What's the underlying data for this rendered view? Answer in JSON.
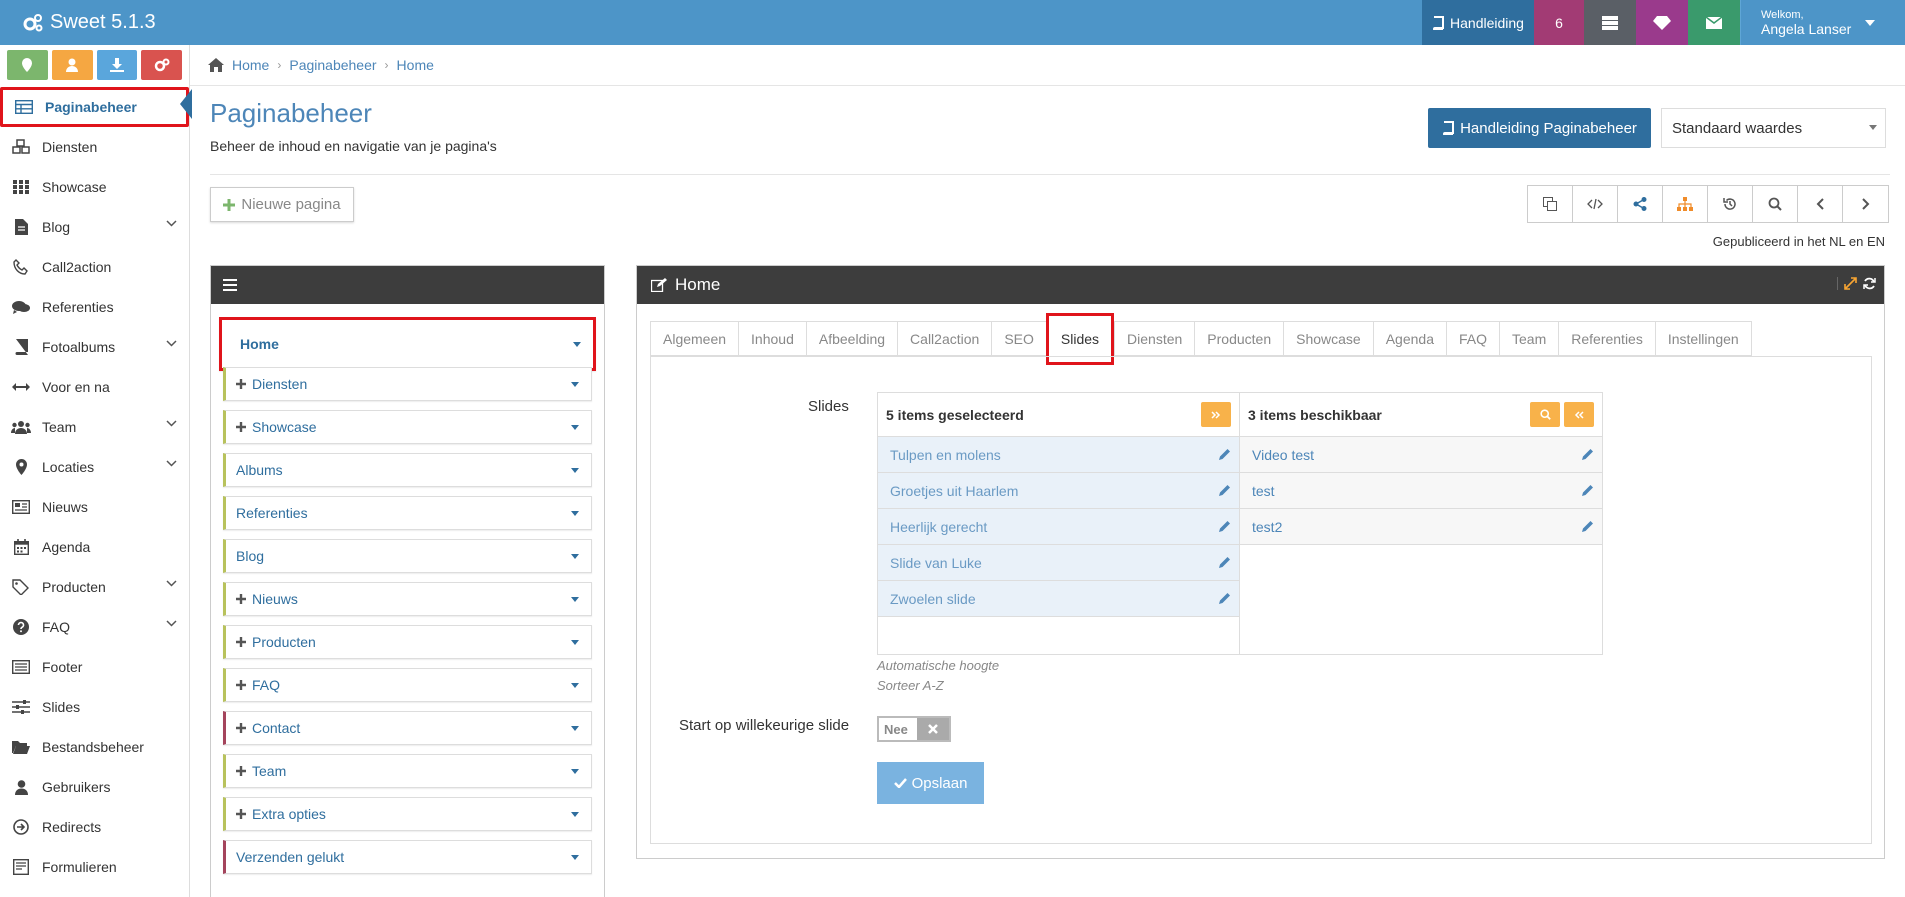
{
  "app": {
    "title": "Sweet 5.1.3"
  },
  "topbar": {
    "manual_label": "Handleiding",
    "notifications": "6",
    "welcome": "Welkom,",
    "user_name": "Angela Lanser"
  },
  "sidebar": {
    "items": [
      {
        "label": "Paginabeheer",
        "icon": "table-icon",
        "chevron": false,
        "active": true
      },
      {
        "label": "Diensten",
        "icon": "cubes-icon",
        "chevron": false
      },
      {
        "label": "Showcase",
        "icon": "grid-icon",
        "chevron": false
      },
      {
        "label": "Blog",
        "icon": "file-icon",
        "chevron": true
      },
      {
        "label": "Call2action",
        "icon": "phone-icon",
        "chevron": false
      },
      {
        "label": "Referenties",
        "icon": "comments-icon",
        "chevron": false
      },
      {
        "label": "Fotoalbums",
        "icon": "book-icon",
        "chevron": true
      },
      {
        "label": "Voor en na",
        "icon": "arrows-h-icon",
        "chevron": false
      },
      {
        "label": "Team",
        "icon": "users-icon",
        "chevron": true
      },
      {
        "label": "Locaties",
        "icon": "map-marker-icon",
        "chevron": true
      },
      {
        "label": "Nieuws",
        "icon": "newspaper-icon",
        "chevron": false
      },
      {
        "label": "Agenda",
        "icon": "calendar-icon",
        "chevron": false
      },
      {
        "label": "Producten",
        "icon": "tags-icon",
        "chevron": true
      },
      {
        "label": "FAQ",
        "icon": "question-icon",
        "chevron": true
      },
      {
        "label": "Footer",
        "icon": "list-alt-icon",
        "chevron": false
      },
      {
        "label": "Slides",
        "icon": "sliders-icon",
        "chevron": false
      },
      {
        "label": "Bestandsbeheer",
        "icon": "folder-open-icon",
        "chevron": false
      },
      {
        "label": "Gebruikers",
        "icon": "user-icon",
        "chevron": false
      },
      {
        "label": "Redirects",
        "icon": "arrow-circle-icon",
        "chevron": false
      },
      {
        "label": "Formulieren",
        "icon": "form-icon",
        "chevron": false
      }
    ]
  },
  "breadcrumb": [
    "Home",
    "Paginabeheer",
    "Home"
  ],
  "page": {
    "title": "Paginabeheer",
    "subtitle": "Beheer de inhoud en navigatie van je pagina's",
    "manual_button": "Handleiding Paginabeheer",
    "select_value": "Standaard waardes",
    "new_page": "Nieuwe pagina",
    "published": "Gepubliceerd in het NL en EN"
  },
  "tree": {
    "items": [
      {
        "label": "Home",
        "plus": false,
        "color": "red"
      },
      {
        "label": "Diensten",
        "plus": true,
        "color": "olive"
      },
      {
        "label": "Showcase",
        "plus": true,
        "color": "olive"
      },
      {
        "label": "Albums",
        "plus": false,
        "color": "olive"
      },
      {
        "label": "Referenties",
        "plus": false,
        "color": "olive"
      },
      {
        "label": "Blog",
        "plus": false,
        "color": "olive"
      },
      {
        "label": "Nieuws",
        "plus": true,
        "color": "olive"
      },
      {
        "label": "Producten",
        "plus": true,
        "color": "olive"
      },
      {
        "label": "FAQ",
        "plus": true,
        "color": "olive"
      },
      {
        "label": "Contact",
        "plus": true,
        "color": "red"
      },
      {
        "label": "Team",
        "plus": true,
        "color": "olive"
      },
      {
        "label": "Extra opties",
        "plus": true,
        "color": "olive"
      },
      {
        "label": "Verzenden gelukt",
        "plus": false,
        "color": "red"
      }
    ]
  },
  "editor": {
    "title": "Home",
    "tabs": [
      "Algemeen",
      "Inhoud",
      "Afbeelding",
      "Call2action",
      "SEO",
      "Slides",
      "Diensten",
      "Producten",
      "Showcase",
      "Agenda",
      "FAQ",
      "Team",
      "Referenties",
      "Instellingen"
    ],
    "active_tab": "Slides",
    "slides_label": "Slides",
    "selected_header": "5 items geselecteerd",
    "available_header": "3 items beschikbaar",
    "selected": [
      "Tulpen en molens",
      "Groetjes uit Haarlem",
      "Heerlijk gerecht",
      "Slide van Luke",
      "Zwoelen slide"
    ],
    "available": [
      "Video test",
      "test",
      "test2"
    ],
    "hint_height": "Automatische hoogte",
    "hint_sort": "Sorteer A-Z",
    "random_label": "Start op willekeurige slide",
    "toggle_value": "Nee",
    "save_label": "Opslaan"
  },
  "colors": {
    "topbar": "#4d95c8",
    "accent": "#2f6e9e",
    "highlight": "#e0141b",
    "orange": "#f8b24a"
  }
}
